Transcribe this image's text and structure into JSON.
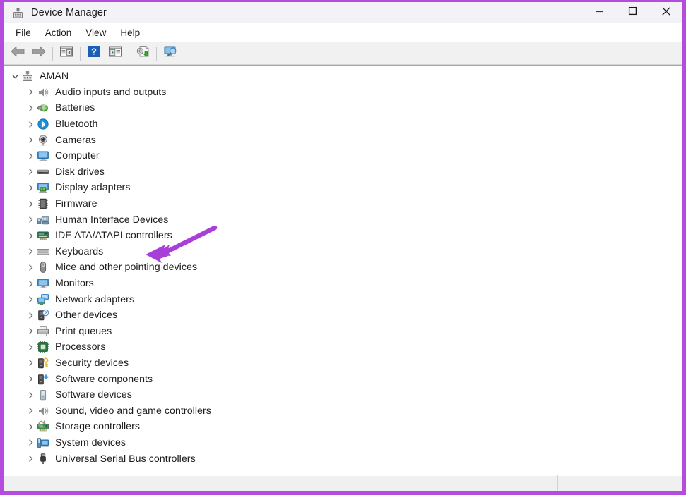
{
  "window": {
    "title": "Device Manager",
    "app_icon": "device-manager-icon",
    "controls": {
      "minimize": "–",
      "maximize": "□",
      "close": "✕"
    },
    "border_color": "#b44ce0"
  },
  "menubar": {
    "items": [
      {
        "label": "File"
      },
      {
        "label": "Action"
      },
      {
        "label": "View"
      },
      {
        "label": "Help"
      }
    ]
  },
  "toolbar": {
    "buttons": [
      {
        "name": "back-button",
        "icon": "left-arrow-icon",
        "tooltip": "Back"
      },
      {
        "name": "forward-button",
        "icon": "right-arrow-icon",
        "tooltip": "Forward"
      },
      {
        "name": "show-hide-console-tree-button",
        "icon": "console-tree-icon",
        "tooltip": "Show/Hide Console Tree"
      },
      {
        "name": "help-button",
        "icon": "question-mark-icon",
        "tooltip": "Help"
      },
      {
        "name": "properties-button",
        "icon": "properties-window-icon",
        "tooltip": "Properties"
      },
      {
        "name": "update-driver-button",
        "icon": "update-driver-icon",
        "tooltip": "Update driver"
      },
      {
        "name": "scan-hardware-changes-button",
        "icon": "scan-monitor-icon",
        "tooltip": "Scan for hardware changes"
      }
    ]
  },
  "tree": {
    "root": {
      "label": "AMAN",
      "icon": "computer-root-icon",
      "expanded": true,
      "twisty": "⌄"
    },
    "twisty_collapsed": "›",
    "items": [
      {
        "label": "Audio inputs and outputs",
        "icon": "speaker-icon"
      },
      {
        "label": "Batteries",
        "icon": "battery-icon"
      },
      {
        "label": "Bluetooth",
        "icon": "bluetooth-icon"
      },
      {
        "label": "Cameras",
        "icon": "camera-icon"
      },
      {
        "label": "Computer",
        "icon": "monitor-icon"
      },
      {
        "label": "Disk drives",
        "icon": "disk-drive-icon"
      },
      {
        "label": "Display adapters",
        "icon": "display-adapter-icon"
      },
      {
        "label": "Firmware",
        "icon": "firmware-chip-icon"
      },
      {
        "label": "Human Interface Devices",
        "icon": "hid-icon"
      },
      {
        "label": "IDE ATA/ATAPI controllers",
        "icon": "ide-controller-icon"
      },
      {
        "label": "Keyboards",
        "icon": "keyboard-icon"
      },
      {
        "label": "Mice and other pointing devices",
        "icon": "mouse-icon"
      },
      {
        "label": "Monitors",
        "icon": "monitor-icon"
      },
      {
        "label": "Network adapters",
        "icon": "network-adapter-icon"
      },
      {
        "label": "Other devices",
        "icon": "other-device-question-icon"
      },
      {
        "label": "Print queues",
        "icon": "printer-icon"
      },
      {
        "label": "Processors",
        "icon": "processor-chip-icon"
      },
      {
        "label": "Security devices",
        "icon": "security-key-icon"
      },
      {
        "label": "Software components",
        "icon": "software-component-icon"
      },
      {
        "label": "Software devices",
        "icon": "software-device-icon"
      },
      {
        "label": "Sound, video and game controllers",
        "icon": "speaker-icon"
      },
      {
        "label": "Storage controllers",
        "icon": "storage-controller-icon"
      },
      {
        "label": "System devices",
        "icon": "system-device-icon"
      },
      {
        "label": "Universal Serial Bus controllers",
        "icon": "usb-icon"
      }
    ]
  },
  "statusbar": {
    "panes": [
      "",
      "",
      ""
    ]
  },
  "annotation": {
    "type": "arrow",
    "color": "#a93fd9",
    "points_to": "Display adapters"
  }
}
